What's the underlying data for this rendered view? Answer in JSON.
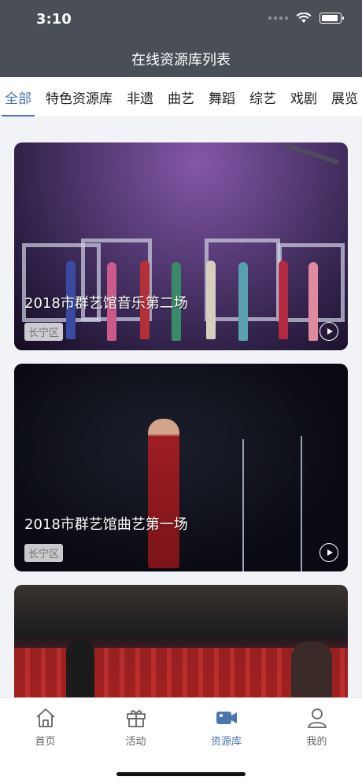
{
  "status_bar": {
    "time": "3:10"
  },
  "header": {
    "title": "在线资源库列表"
  },
  "tabs": [
    {
      "label": "全部",
      "active": true
    },
    {
      "label": "特色资源库"
    },
    {
      "label": "非遗"
    },
    {
      "label": "曲艺"
    },
    {
      "label": "舞蹈"
    },
    {
      "label": "综艺"
    },
    {
      "label": "戏剧"
    },
    {
      "label": "展览"
    }
  ],
  "cards": [
    {
      "title": "2018市群艺馆音乐第二场",
      "tag": "长宁区"
    },
    {
      "title": "2018市群艺馆曲艺第一场",
      "tag": "长宁区"
    },
    {
      "title": "",
      "tag": ""
    }
  ],
  "bottom_nav": [
    {
      "label": "首页",
      "icon": "home-icon"
    },
    {
      "label": "活动",
      "icon": "gift-icon"
    },
    {
      "label": "资源库",
      "icon": "video-camera-icon",
      "active": true
    },
    {
      "label": "我的",
      "icon": "user-icon"
    }
  ],
  "colors": {
    "accent": "#4a77b0",
    "header_bg": "#4a4e57"
  }
}
